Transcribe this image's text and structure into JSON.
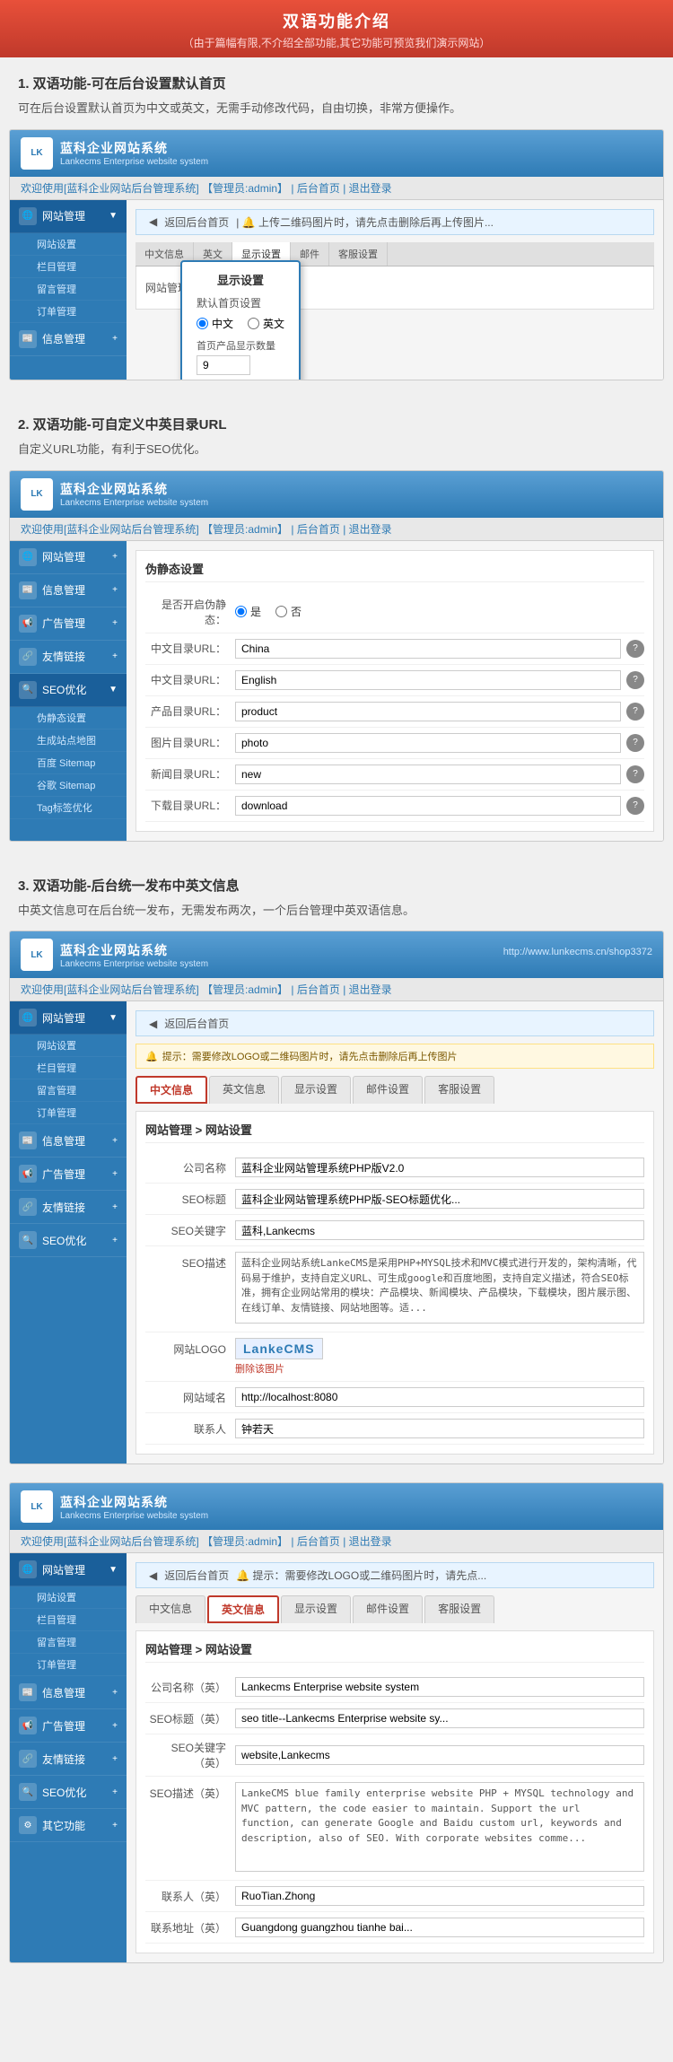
{
  "header": {
    "title": "双语功能介绍",
    "subtitle": "（由于篇幅有限,不介绍全部功能,其它功能可预览我们演示网站）"
  },
  "sections": [
    {
      "id": 1,
      "title": "1. 双语功能-可在后台设置默认首页",
      "desc": "可在后台设置默认首页为中文或英文，无需手动修改代码，自由切换，非常方便操作。"
    },
    {
      "id": 2,
      "title": "2. 双语功能-可自定义中英目录URL",
      "desc": "自定义URL功能，有利于SEO优化。"
    },
    {
      "id": 3,
      "title": "3. 双语功能-后台统一发布中英文信息",
      "desc": "中英文信息可在后台统一发布，无需发布两次，一个后台管理中英双语信息。"
    }
  ],
  "cms": {
    "logo_title": "蓝科企业网站系统",
    "logo_subtitle": "Lankecms Enterprise website system",
    "welcome": "欢迎使用[蓝科企业网站后台管理系统]",
    "admin": "【管理员:admin】",
    "nav_home": "后台首页",
    "nav_logout": "退出登录",
    "website_path": "http://www.lunkecms.cn/shop3372",
    "breadcrumb_back": "返回后台首页",
    "warning": "提示：需要修改LOGO或二维码图片时，请先点击删除后再上传图片"
  },
  "screenshot1": {
    "sidebar": {
      "items": [
        {
          "label": "网站管理",
          "icon": "🌐"
        },
        {
          "label": "信息管理",
          "icon": "📰"
        }
      ],
      "sub_items": [
        "网站设置",
        "栏目管理",
        "留言管理",
        "订单管理"
      ]
    },
    "tabs": [
      "中文信息",
      "英文",
      "显示设置",
      "邮件",
      ""
    ],
    "popup": {
      "title": "显示设置",
      "label": "默认首页设置",
      "option1": "中文",
      "option2": "英文",
      "input_label": "首页产品显示数量",
      "input_value": "9"
    }
  },
  "screenshot2": {
    "sidebar": {
      "items": [
        {
          "label": "网站管理",
          "icon": "🌐"
        },
        {
          "label": "信息管理",
          "icon": "📰"
        },
        {
          "label": "广告管理",
          "icon": "📢"
        },
        {
          "label": "友情链接",
          "icon": "🔗"
        },
        {
          "label": "SEO优化",
          "icon": "🔍"
        }
      ],
      "seo_sub": [
        "伪静态设置",
        "生成站点地图",
        "百度 Sitemap",
        "谷歌 Sitemap",
        "Tag标签优化"
      ]
    },
    "form_title": "伪静态设置",
    "form_rows": [
      {
        "label": "是否开启伪静态：",
        "value": "radio",
        "options": [
          "是",
          "否"
        ]
      },
      {
        "label": "中文目录URL：",
        "value": "China",
        "hint": true
      },
      {
        "label": "中文目录URL：",
        "value": "English",
        "hint": true
      },
      {
        "label": "产品目录URL：",
        "value": "product",
        "hint": true
      },
      {
        "label": "图片目录URL：",
        "value": "photo",
        "hint": true
      },
      {
        "label": "新闻目录URL：",
        "value": "new",
        "hint": true
      },
      {
        "label": "下载目录URL：",
        "value": "download",
        "hint": true
      }
    ]
  },
  "screenshot3": {
    "tabs": [
      "中文信息",
      "英文信息",
      "显示设置",
      "邮件设置",
      "客服设置"
    ],
    "active_tab": 0,
    "form_title": "网站管理 > 网站设置",
    "form_rows": [
      {
        "label": "公司名称",
        "value": "蓝科企业网站管理系统PHP版V2.0"
      },
      {
        "label": "SEO标题",
        "value": "蓝科企业网站管理系统PHP版-SEO标题优化..."
      },
      {
        "label": "SEO关键字",
        "value": "蓝科,Lankecms"
      },
      {
        "label": "SEO描述",
        "value": "蓝科企业网站系统LankeCMS是采用PHP+MYSQL技术和MVC模式进行开发的，架构清晰，代码易于维护，支持自定义URL、可生成google和百度地图，支持自定义描述，符合SEO标准，拥有企业网站常用的模块：产品模块、新闻模块、产品模块，下载模块，图片展示图、在线订单、友情链接、网站地图等。适...",
        "type": "textarea"
      },
      {
        "label": "网站LOGO",
        "value": "logo",
        "type": "logo"
      },
      {
        "label": "网站域名",
        "value": "http://localhost:8080"
      },
      {
        "label": "联系人",
        "value": "钟若天"
      }
    ]
  },
  "screenshot4": {
    "tabs": [
      "中文信息",
      "英文信息",
      "显示设置",
      "邮件设置",
      "客服设置"
    ],
    "active_tab": 1,
    "form_title": "网站管理 > 网站设置",
    "form_rows": [
      {
        "label": "公司名称（英）",
        "value": "Lankecms Enterprise website system"
      },
      {
        "label": "SEO标题（英）",
        "value": "seo title--Lankecms Enterprise website sy..."
      },
      {
        "label": "SEO关键字（英）",
        "value": "website,Lankecms"
      },
      {
        "label": "SEO描述（英）",
        "value": "LankeCMS blue family enterprise website PHP + MYSQL technology and MVC pattern, the code easier to maintain. Support the url function, can generate Google and Baidu custom url, keywords and description, also of SEO. With corporate websites comme...",
        "type": "textarea"
      },
      {
        "label": "联系人（英）",
        "value": "RuoTian.Zhong"
      },
      {
        "label": "联系地址（英）",
        "value": "Guangdong guangzhou tianhe bai..."
      }
    ]
  },
  "logo_text": "LankeCMS",
  "remove_img_label": "删除该图片",
  "sidebar_items": {
    "website_mgmt": "网站管理",
    "info_mgmt": "信息管理",
    "ad_mgmt": "广告管理",
    "friend_link": "友情链接",
    "seo": "SEO优化",
    "other": "其它功能",
    "sub_site_settings": "网站设置",
    "sub_column_mgmt": "栏目管理",
    "sub_message_mgmt": "留言管理",
    "sub_order_mgmt": "订单管理"
  }
}
